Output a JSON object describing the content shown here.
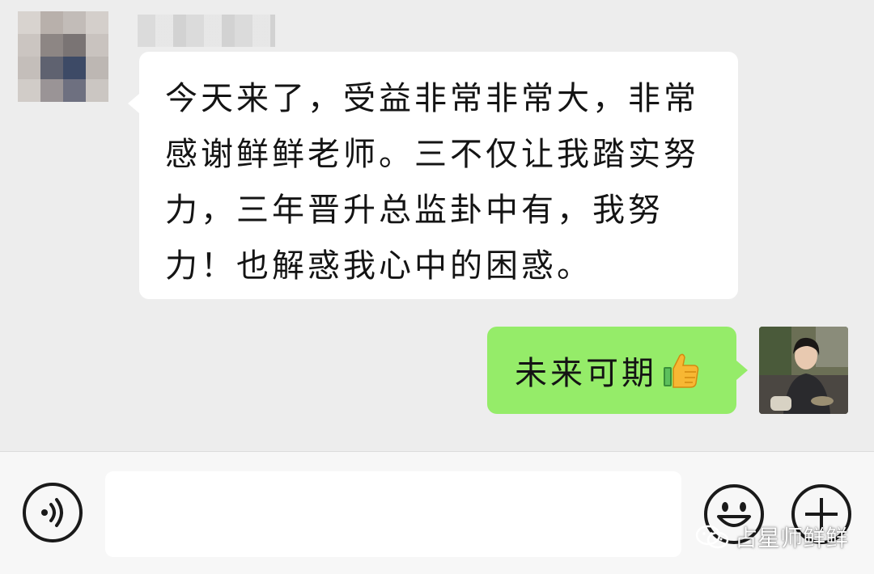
{
  "messages": [
    {
      "direction": "incoming",
      "text": "今天来了，受益非常非常大，非常感谢鲜鲜老师。三不仅让我踏实努力，三年晋升总监卦中有，我努力！也解惑我心中的困惑。",
      "lines": [
        "今天来了，受益非常非常大，非常",
        "感谢鲜鲜老师。三不仅让我踏实努",
        "力，三年晋升总监卦中有，我努",
        "力！也解惑我心中的困惑。"
      ],
      "avatar_icon": "blurred-avatar",
      "sender_name_icon": "blurred-name",
      "bubble_color": "#ffffff"
    },
    {
      "direction": "outgoing",
      "text": "未来可期",
      "emoji": "thumbs-up-icon",
      "avatar_icon": "user-photo-avatar",
      "bubble_color": "#95ec69"
    }
  ],
  "input_bar": {
    "voice_icon": "voice-icon",
    "input_value": "",
    "emoji_icon": "emoji-icon",
    "plus_icon": "plus-icon"
  },
  "watermark": {
    "icon": "wechat-official-account-icon",
    "text": "占星师鲜鲜"
  },
  "colors": {
    "chat_background": "#ededed",
    "outgoing_bubble": "#95ec69",
    "incoming_bubble": "#ffffff",
    "input_bar_background": "#f7f7f7"
  }
}
